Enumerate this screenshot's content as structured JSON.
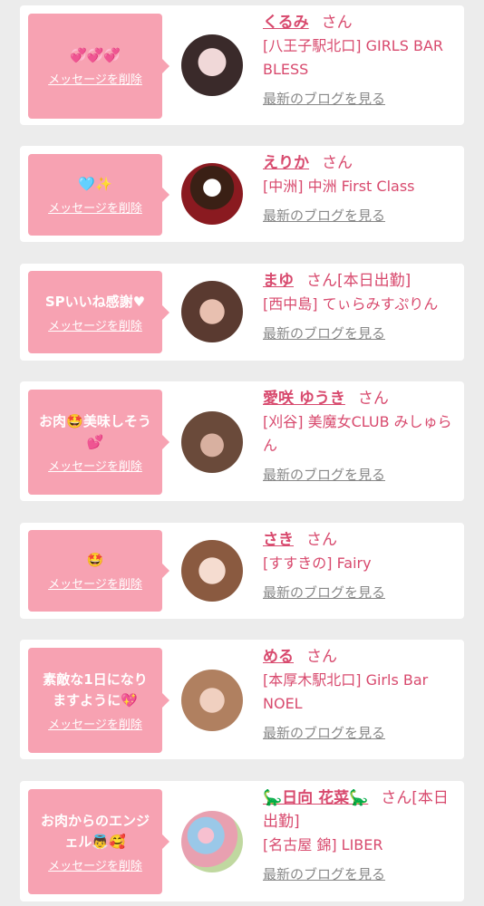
{
  "cards": [
    {
      "message": "💞💞💞",
      "delete_label": "メッセージを削除",
      "name": "くるみ",
      "san": "さん",
      "extra": "",
      "shop": "[八王子駅北口] GIRLS BAR BLESS",
      "blog_label": "最新のブログを見る"
    },
    {
      "message": "🩵✨",
      "delete_label": "メッセージを削除",
      "name": "えりか",
      "san": "さん",
      "extra": "",
      "shop": "[中洲] 中洲 First Class",
      "blog_label": "最新のブログを見る"
    },
    {
      "message": "SPいいね感謝♥",
      "delete_label": "メッセージを削除",
      "name": "まゆ",
      "san": "さん",
      "extra": "[本日出勤]",
      "shop": "[西中島] てぃらみすぷりん",
      "blog_label": "最新のブログを見る"
    },
    {
      "message": "お肉🤩美味しそう\n💕",
      "delete_label": "メッセージを削除",
      "name": "愛咲 ゆうき",
      "san": "さん",
      "extra": "",
      "shop": "[刈谷] 美魔女CLUB みしゅらん",
      "blog_label": "最新のブログを見る"
    },
    {
      "message": "🤩",
      "delete_label": "メッセージを削除",
      "name": "さき",
      "san": "さん",
      "extra": "",
      "shop": "[すすきの] Fairy",
      "blog_label": "最新のブログを見る"
    },
    {
      "message": "素敵な1日になり\nますように💖",
      "delete_label": "メッセージを削除",
      "name": "める",
      "san": "さん",
      "extra": "",
      "shop": "[本厚木駅北口] Girls Bar NOEL",
      "blog_label": "最新のブログを見る"
    },
    {
      "message": "お肉からのエンジ\nェル👼🥰",
      "delete_label": "メッセージを削除",
      "name": "🦕日向 花菜🦕",
      "san": "さん",
      "extra": "[本日出勤]",
      "shop": "[名古屋 錦] LIBER",
      "blog_label": "最新のブログを見る"
    }
  ]
}
